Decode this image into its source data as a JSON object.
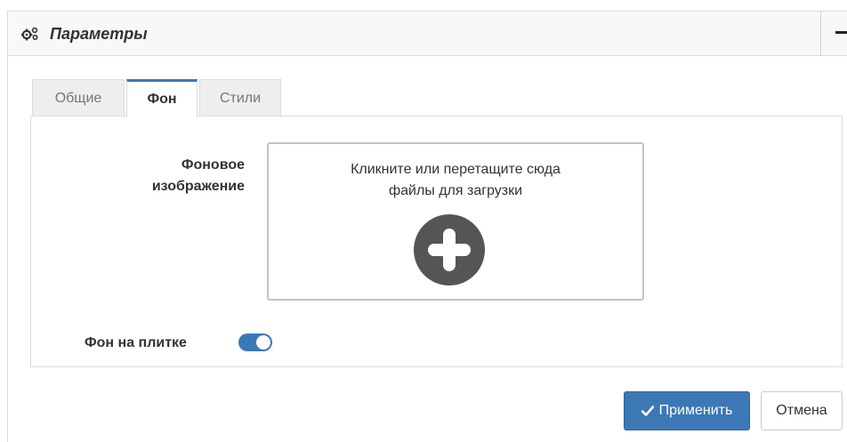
{
  "panel": {
    "title": "Параметры",
    "title_icon": "gears-icon",
    "collapse_icon": "minus-icon"
  },
  "tabs": [
    {
      "label": "Общие",
      "active": false
    },
    {
      "label": "Фон",
      "active": true
    },
    {
      "label": "Стили",
      "active": false
    }
  ],
  "background": {
    "label_line1": "Фоновое",
    "label_line2": "изображение",
    "dropzone_line1": "Кликните или перетащите сюда",
    "dropzone_line2": "файлы для загрузки",
    "dropzone_icon": "plus-circle-icon"
  },
  "tile_background": {
    "label": "Фон на плитке",
    "enabled": true
  },
  "footer": {
    "apply_label": "Применить",
    "apply_icon": "check-icon",
    "cancel_label": "Отмена"
  },
  "colors": {
    "accent": "#3c78b5",
    "icon_dark": "#555555",
    "header_bg": "#f8f8f8"
  }
}
